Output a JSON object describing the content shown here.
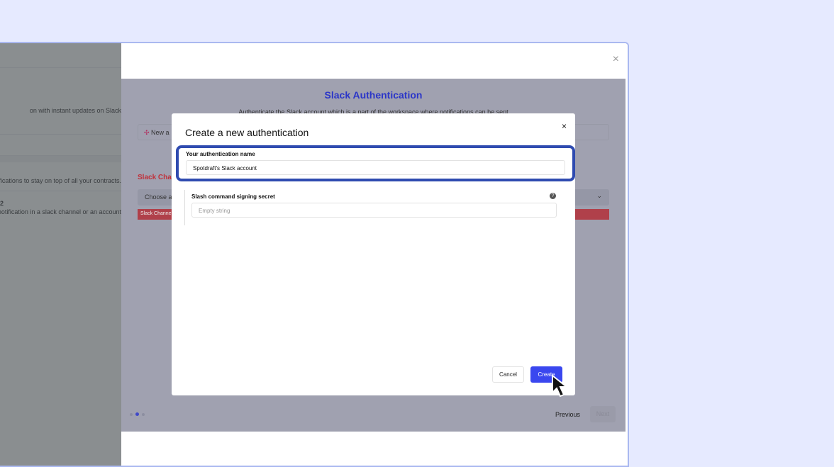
{
  "background_page": {
    "lines": [
      "on with instant updates on Slack",
      "otifications to stay on top of all your contracts.",
      "2",
      "notification in a slack channel or an account"
    ]
  },
  "wizard": {
    "title": "Slack Authentication",
    "subtitle": "Authenticate the Slack account which is a part of the workspace where notifications can be sent",
    "new_auth_label": "New a",
    "channel_label": "Slack Chann",
    "choose_placeholder": "Choose an",
    "error_text": "Slack Channel",
    "previous": "Previous",
    "next": "Next",
    "step": 2,
    "steps": 3,
    "close": "×"
  },
  "modal": {
    "title": "Create a new authentication",
    "close": "×",
    "name_label": "Your authentication name",
    "name_value": "Spotdraft's Slack account",
    "secret_label": "Slash command signing secret",
    "secret_placeholder": "Empty string",
    "help": "?",
    "cancel": "Cancel",
    "create": "Create"
  },
  "colors": {
    "accent": "#3a47ef",
    "title": "#2b36c8",
    "error": "#c0303a"
  }
}
